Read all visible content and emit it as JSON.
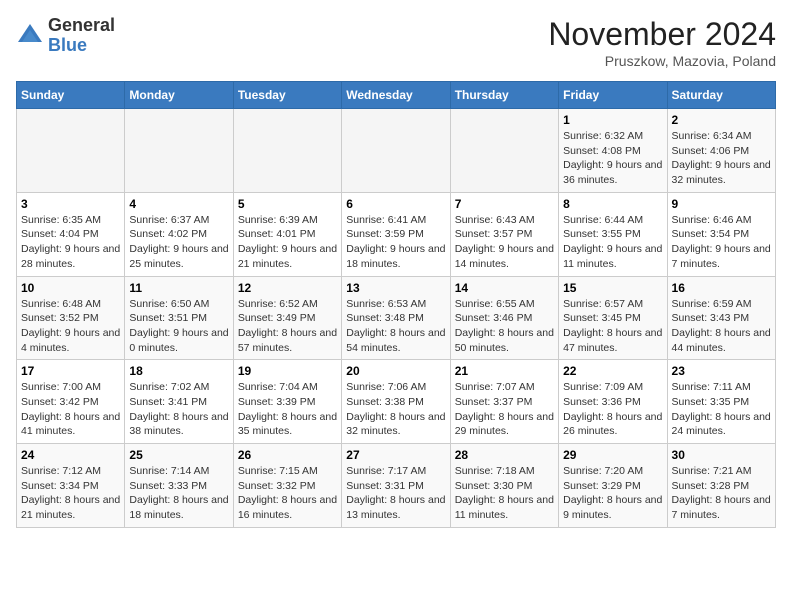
{
  "logo": {
    "general": "General",
    "blue": "Blue"
  },
  "title": "November 2024",
  "location": "Pruszkow, Mazovia, Poland",
  "days_of_week": [
    "Sunday",
    "Monday",
    "Tuesday",
    "Wednesday",
    "Thursday",
    "Friday",
    "Saturday"
  ],
  "weeks": [
    [
      {
        "day": "",
        "info": ""
      },
      {
        "day": "",
        "info": ""
      },
      {
        "day": "",
        "info": ""
      },
      {
        "day": "",
        "info": ""
      },
      {
        "day": "",
        "info": ""
      },
      {
        "day": "1",
        "info": "Sunrise: 6:32 AM\nSunset: 4:08 PM\nDaylight: 9 hours and 36 minutes."
      },
      {
        "day": "2",
        "info": "Sunrise: 6:34 AM\nSunset: 4:06 PM\nDaylight: 9 hours and 32 minutes."
      }
    ],
    [
      {
        "day": "3",
        "info": "Sunrise: 6:35 AM\nSunset: 4:04 PM\nDaylight: 9 hours and 28 minutes."
      },
      {
        "day": "4",
        "info": "Sunrise: 6:37 AM\nSunset: 4:02 PM\nDaylight: 9 hours and 25 minutes."
      },
      {
        "day": "5",
        "info": "Sunrise: 6:39 AM\nSunset: 4:01 PM\nDaylight: 9 hours and 21 minutes."
      },
      {
        "day": "6",
        "info": "Sunrise: 6:41 AM\nSunset: 3:59 PM\nDaylight: 9 hours and 18 minutes."
      },
      {
        "day": "7",
        "info": "Sunrise: 6:43 AM\nSunset: 3:57 PM\nDaylight: 9 hours and 14 minutes."
      },
      {
        "day": "8",
        "info": "Sunrise: 6:44 AM\nSunset: 3:55 PM\nDaylight: 9 hours and 11 minutes."
      },
      {
        "day": "9",
        "info": "Sunrise: 6:46 AM\nSunset: 3:54 PM\nDaylight: 9 hours and 7 minutes."
      }
    ],
    [
      {
        "day": "10",
        "info": "Sunrise: 6:48 AM\nSunset: 3:52 PM\nDaylight: 9 hours and 4 minutes."
      },
      {
        "day": "11",
        "info": "Sunrise: 6:50 AM\nSunset: 3:51 PM\nDaylight: 9 hours and 0 minutes."
      },
      {
        "day": "12",
        "info": "Sunrise: 6:52 AM\nSunset: 3:49 PM\nDaylight: 8 hours and 57 minutes."
      },
      {
        "day": "13",
        "info": "Sunrise: 6:53 AM\nSunset: 3:48 PM\nDaylight: 8 hours and 54 minutes."
      },
      {
        "day": "14",
        "info": "Sunrise: 6:55 AM\nSunset: 3:46 PM\nDaylight: 8 hours and 50 minutes."
      },
      {
        "day": "15",
        "info": "Sunrise: 6:57 AM\nSunset: 3:45 PM\nDaylight: 8 hours and 47 minutes."
      },
      {
        "day": "16",
        "info": "Sunrise: 6:59 AM\nSunset: 3:43 PM\nDaylight: 8 hours and 44 minutes."
      }
    ],
    [
      {
        "day": "17",
        "info": "Sunrise: 7:00 AM\nSunset: 3:42 PM\nDaylight: 8 hours and 41 minutes."
      },
      {
        "day": "18",
        "info": "Sunrise: 7:02 AM\nSunset: 3:41 PM\nDaylight: 8 hours and 38 minutes."
      },
      {
        "day": "19",
        "info": "Sunrise: 7:04 AM\nSunset: 3:39 PM\nDaylight: 8 hours and 35 minutes."
      },
      {
        "day": "20",
        "info": "Sunrise: 7:06 AM\nSunset: 3:38 PM\nDaylight: 8 hours and 32 minutes."
      },
      {
        "day": "21",
        "info": "Sunrise: 7:07 AM\nSunset: 3:37 PM\nDaylight: 8 hours and 29 minutes."
      },
      {
        "day": "22",
        "info": "Sunrise: 7:09 AM\nSunset: 3:36 PM\nDaylight: 8 hours and 26 minutes."
      },
      {
        "day": "23",
        "info": "Sunrise: 7:11 AM\nSunset: 3:35 PM\nDaylight: 8 hours and 24 minutes."
      }
    ],
    [
      {
        "day": "24",
        "info": "Sunrise: 7:12 AM\nSunset: 3:34 PM\nDaylight: 8 hours and 21 minutes."
      },
      {
        "day": "25",
        "info": "Sunrise: 7:14 AM\nSunset: 3:33 PM\nDaylight: 8 hours and 18 minutes."
      },
      {
        "day": "26",
        "info": "Sunrise: 7:15 AM\nSunset: 3:32 PM\nDaylight: 8 hours and 16 minutes."
      },
      {
        "day": "27",
        "info": "Sunrise: 7:17 AM\nSunset: 3:31 PM\nDaylight: 8 hours and 13 minutes."
      },
      {
        "day": "28",
        "info": "Sunrise: 7:18 AM\nSunset: 3:30 PM\nDaylight: 8 hours and 11 minutes."
      },
      {
        "day": "29",
        "info": "Sunrise: 7:20 AM\nSunset: 3:29 PM\nDaylight: 8 hours and 9 minutes."
      },
      {
        "day": "30",
        "info": "Sunrise: 7:21 AM\nSunset: 3:28 PM\nDaylight: 8 hours and 7 minutes."
      }
    ]
  ]
}
